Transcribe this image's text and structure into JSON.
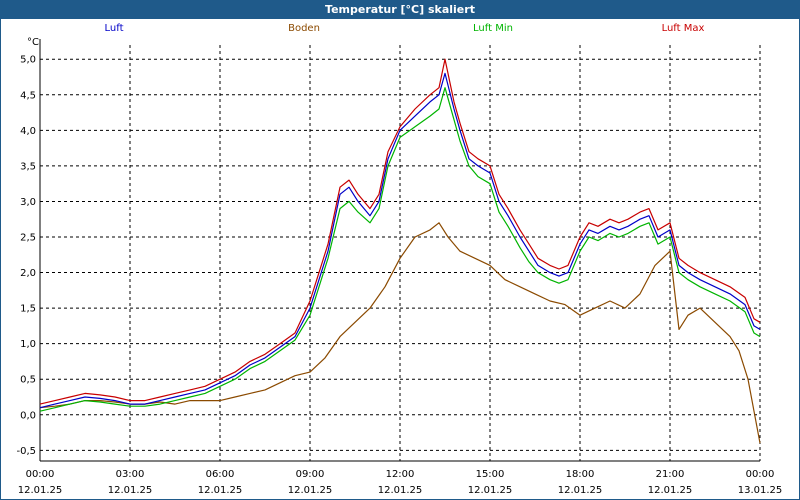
{
  "window": {
    "title": "Temperatur [°C] skaliert"
  },
  "chart_data": {
    "type": "line",
    "title": "Temperatur [°C] skaliert",
    "ylabel": "°C",
    "xlabel": "",
    "ylim": [
      -0.65,
      5.2
    ],
    "xlim": [
      0,
      24
    ],
    "yticks": [
      -0.5,
      0.0,
      0.5,
      1.0,
      1.5,
      2.0,
      2.5,
      3.0,
      3.5,
      4.0,
      4.5,
      5.0
    ],
    "ytick_labels": [
      "-0,5",
      "0,0",
      "0,5",
      "1,0",
      "1,5",
      "2,0",
      "2,5",
      "3,0",
      "3,5",
      "4,0",
      "4,5",
      "5,0"
    ],
    "xticks": [
      0,
      3,
      6,
      9,
      12,
      15,
      18,
      21,
      24
    ],
    "xtick_labels": [
      {
        "time": "00:00",
        "date": "12.01.25"
      },
      {
        "time": "03:00",
        "date": "12.01.25"
      },
      {
        "time": "06:00",
        "date": "12.01.25"
      },
      {
        "time": "09:00",
        "date": "12.01.25"
      },
      {
        "time": "12:00",
        "date": "12.01.25"
      },
      {
        "time": "15:00",
        "date": "12.01.25"
      },
      {
        "time": "18:00",
        "date": "12.01.25"
      },
      {
        "time": "21:00",
        "date": "12.01.25"
      },
      {
        "time": "00:00",
        "date": "13.01.25"
      }
    ],
    "grid": true,
    "legend_position": "top",
    "series": [
      {
        "name": "Luft",
        "color": "#0000c8",
        "points": [
          [
            0,
            0.1
          ],
          [
            0.5,
            0.15
          ],
          [
            1,
            0.2
          ],
          [
            1.5,
            0.25
          ],
          [
            2,
            0.23
          ],
          [
            2.5,
            0.2
          ],
          [
            3,
            0.15
          ],
          [
            3.5,
            0.15
          ],
          [
            4,
            0.2
          ],
          [
            4.5,
            0.25
          ],
          [
            5,
            0.3
          ],
          [
            5.5,
            0.35
          ],
          [
            6,
            0.45
          ],
          [
            6.5,
            0.55
          ],
          [
            7,
            0.7
          ],
          [
            7.5,
            0.8
          ],
          [
            8,
            0.95
          ],
          [
            8.5,
            1.1
          ],
          [
            9,
            1.5
          ],
          [
            9.3,
            1.9
          ],
          [
            9.6,
            2.3
          ],
          [
            10,
            3.1
          ],
          [
            10.3,
            3.2
          ],
          [
            10.6,
            3.0
          ],
          [
            11,
            2.8
          ],
          [
            11.3,
            3.0
          ],
          [
            11.6,
            3.6
          ],
          [
            12,
            4.0
          ],
          [
            12.5,
            4.2
          ],
          [
            13,
            4.4
          ],
          [
            13.3,
            4.5
          ],
          [
            13.5,
            4.8
          ],
          [
            13.8,
            4.3
          ],
          [
            14,
            4.0
          ],
          [
            14.3,
            3.6
          ],
          [
            14.6,
            3.5
          ],
          [
            15,
            3.4
          ],
          [
            15.3,
            3.0
          ],
          [
            15.6,
            2.8
          ],
          [
            16,
            2.5
          ],
          [
            16.3,
            2.3
          ],
          [
            16.6,
            2.1
          ],
          [
            17,
            2.0
          ],
          [
            17.3,
            1.95
          ],
          [
            17.6,
            2.0
          ],
          [
            18,
            2.4
          ],
          [
            18.3,
            2.6
          ],
          [
            18.6,
            2.55
          ],
          [
            19,
            2.65
          ],
          [
            19.3,
            2.6
          ],
          [
            19.6,
            2.65
          ],
          [
            20,
            2.75
          ],
          [
            20.3,
            2.8
          ],
          [
            20.6,
            2.5
          ],
          [
            21,
            2.6
          ],
          [
            21.3,
            2.1
          ],
          [
            21.6,
            2.0
          ],
          [
            22,
            1.9
          ],
          [
            22.5,
            1.8
          ],
          [
            23,
            1.7
          ],
          [
            23.5,
            1.55
          ],
          [
            23.8,
            1.25
          ],
          [
            24,
            1.2
          ]
        ]
      },
      {
        "name": "Boden",
        "color": "#8b4a00",
        "points": [
          [
            0,
            0.1
          ],
          [
            0.5,
            0.12
          ],
          [
            1,
            0.15
          ],
          [
            1.5,
            0.2
          ],
          [
            2,
            0.2
          ],
          [
            2.5,
            0.18
          ],
          [
            3,
            0.15
          ],
          [
            3.5,
            0.15
          ],
          [
            4,
            0.18
          ],
          [
            4.5,
            0.15
          ],
          [
            5,
            0.2
          ],
          [
            5.5,
            0.2
          ],
          [
            6,
            0.2
          ],
          [
            6.5,
            0.25
          ],
          [
            7,
            0.3
          ],
          [
            7.5,
            0.35
          ],
          [
            8,
            0.45
          ],
          [
            8.5,
            0.55
          ],
          [
            9,
            0.6
          ],
          [
            9.5,
            0.8
          ],
          [
            10,
            1.1
          ],
          [
            10.5,
            1.3
          ],
          [
            11,
            1.5
          ],
          [
            11.5,
            1.8
          ],
          [
            12,
            2.2
          ],
          [
            12.5,
            2.5
          ],
          [
            13,
            2.6
          ],
          [
            13.3,
            2.7
          ],
          [
            13.6,
            2.5
          ],
          [
            14,
            2.3
          ],
          [
            14.5,
            2.2
          ],
          [
            15,
            2.1
          ],
          [
            15.5,
            1.9
          ],
          [
            16,
            1.8
          ],
          [
            16.5,
            1.7
          ],
          [
            17,
            1.6
          ],
          [
            17.5,
            1.55
          ],
          [
            18,
            1.4
          ],
          [
            18.5,
            1.5
          ],
          [
            19,
            1.6
          ],
          [
            19.5,
            1.5
          ],
          [
            20,
            1.7
          ],
          [
            20.5,
            2.1
          ],
          [
            21,
            2.3
          ],
          [
            21.3,
            1.2
          ],
          [
            21.6,
            1.4
          ],
          [
            22,
            1.5
          ],
          [
            22.5,
            1.3
          ],
          [
            23,
            1.1
          ],
          [
            23.3,
            0.9
          ],
          [
            23.6,
            0.5
          ],
          [
            24,
            -0.4
          ]
        ]
      },
      {
        "name": "Luft Min",
        "color": "#00b400",
        "points": [
          [
            0,
            0.05
          ],
          [
            0.5,
            0.1
          ],
          [
            1,
            0.15
          ],
          [
            1.5,
            0.2
          ],
          [
            2,
            0.18
          ],
          [
            2.5,
            0.15
          ],
          [
            3,
            0.12
          ],
          [
            3.5,
            0.12
          ],
          [
            4,
            0.15
          ],
          [
            4.5,
            0.2
          ],
          [
            5,
            0.25
          ],
          [
            5.5,
            0.3
          ],
          [
            6,
            0.4
          ],
          [
            6.5,
            0.5
          ],
          [
            7,
            0.65
          ],
          [
            7.5,
            0.75
          ],
          [
            8,
            0.9
          ],
          [
            8.5,
            1.05
          ],
          [
            9,
            1.4
          ],
          [
            9.3,
            1.8
          ],
          [
            9.6,
            2.2
          ],
          [
            10,
            2.9
          ],
          [
            10.3,
            3.0
          ],
          [
            10.6,
            2.85
          ],
          [
            11,
            2.7
          ],
          [
            11.3,
            2.9
          ],
          [
            11.6,
            3.5
          ],
          [
            12,
            3.9
          ],
          [
            12.5,
            4.05
          ],
          [
            13,
            4.2
          ],
          [
            13.3,
            4.3
          ],
          [
            13.5,
            4.6
          ],
          [
            13.8,
            4.15
          ],
          [
            14,
            3.85
          ],
          [
            14.3,
            3.5
          ],
          [
            14.6,
            3.35
          ],
          [
            15,
            3.25
          ],
          [
            15.3,
            2.85
          ],
          [
            15.6,
            2.65
          ],
          [
            16,
            2.35
          ],
          [
            16.3,
            2.15
          ],
          [
            16.6,
            2.0
          ],
          [
            17,
            1.9
          ],
          [
            17.3,
            1.85
          ],
          [
            17.6,
            1.9
          ],
          [
            18,
            2.3
          ],
          [
            18.3,
            2.5
          ],
          [
            18.6,
            2.45
          ],
          [
            19,
            2.55
          ],
          [
            19.3,
            2.5
          ],
          [
            19.6,
            2.55
          ],
          [
            20,
            2.65
          ],
          [
            20.3,
            2.7
          ],
          [
            20.6,
            2.4
          ],
          [
            21,
            2.5
          ],
          [
            21.3,
            2.0
          ],
          [
            21.6,
            1.9
          ],
          [
            22,
            1.8
          ],
          [
            22.5,
            1.7
          ],
          [
            23,
            1.6
          ],
          [
            23.5,
            1.45
          ],
          [
            23.8,
            1.15
          ],
          [
            24,
            1.1
          ]
        ]
      },
      {
        "name": "Luft Max",
        "color": "#c80000",
        "points": [
          [
            0,
            0.15
          ],
          [
            0.5,
            0.2
          ],
          [
            1,
            0.25
          ],
          [
            1.5,
            0.3
          ],
          [
            2,
            0.28
          ],
          [
            2.5,
            0.25
          ],
          [
            3,
            0.2
          ],
          [
            3.5,
            0.2
          ],
          [
            4,
            0.25
          ],
          [
            4.5,
            0.3
          ],
          [
            5,
            0.35
          ],
          [
            5.5,
            0.4
          ],
          [
            6,
            0.5
          ],
          [
            6.5,
            0.6
          ],
          [
            7,
            0.75
          ],
          [
            7.5,
            0.85
          ],
          [
            8,
            1.0
          ],
          [
            8.5,
            1.15
          ],
          [
            9,
            1.6
          ],
          [
            9.3,
            2.0
          ],
          [
            9.6,
            2.4
          ],
          [
            10,
            3.2
          ],
          [
            10.3,
            3.3
          ],
          [
            10.6,
            3.1
          ],
          [
            11,
            2.9
          ],
          [
            11.3,
            3.1
          ],
          [
            11.6,
            3.7
          ],
          [
            12,
            4.05
          ],
          [
            12.5,
            4.3
          ],
          [
            13,
            4.5
          ],
          [
            13.3,
            4.6
          ],
          [
            13.5,
            5.0
          ],
          [
            13.8,
            4.4
          ],
          [
            14,
            4.1
          ],
          [
            14.3,
            3.7
          ],
          [
            14.6,
            3.6
          ],
          [
            15,
            3.5
          ],
          [
            15.3,
            3.1
          ],
          [
            15.6,
            2.9
          ],
          [
            16,
            2.6
          ],
          [
            16.3,
            2.4
          ],
          [
            16.6,
            2.2
          ],
          [
            17,
            2.1
          ],
          [
            17.3,
            2.05
          ],
          [
            17.6,
            2.1
          ],
          [
            18,
            2.5
          ],
          [
            18.3,
            2.7
          ],
          [
            18.6,
            2.65
          ],
          [
            19,
            2.75
          ],
          [
            19.3,
            2.7
          ],
          [
            19.6,
            2.75
          ],
          [
            20,
            2.85
          ],
          [
            20.3,
            2.9
          ],
          [
            20.6,
            2.6
          ],
          [
            21,
            2.7
          ],
          [
            21.3,
            2.2
          ],
          [
            21.6,
            2.1
          ],
          [
            22,
            2.0
          ],
          [
            22.5,
            1.9
          ],
          [
            23,
            1.8
          ],
          [
            23.5,
            1.65
          ],
          [
            23.8,
            1.35
          ],
          [
            24,
            1.3
          ]
        ]
      }
    ]
  }
}
